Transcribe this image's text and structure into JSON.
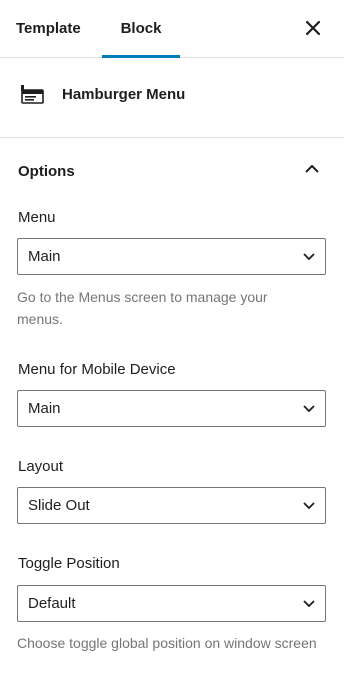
{
  "tabs": [
    {
      "label": "Template",
      "active": false
    },
    {
      "label": "Block",
      "active": true
    }
  ],
  "close_icon": "close-icon",
  "block": {
    "icon": "hamburger-menu-block-icon",
    "title": "Hamburger Menu"
  },
  "panel": {
    "title": "Options",
    "expanded": true
  },
  "fields": {
    "menu": {
      "label": "Menu",
      "value": "Main",
      "help": "Go to the Menus screen to manage your menus."
    },
    "mobile_menu": {
      "label": "Menu for Mobile Device",
      "value": "Main"
    },
    "layout": {
      "label": "Layout",
      "value": "Slide Out"
    },
    "toggle_position": {
      "label": "Toggle Position",
      "value": "Default",
      "help": "Choose toggle global position on window screen"
    }
  },
  "colors": {
    "accent": "#007cba",
    "border": "#757575",
    "help_text": "#757575"
  }
}
